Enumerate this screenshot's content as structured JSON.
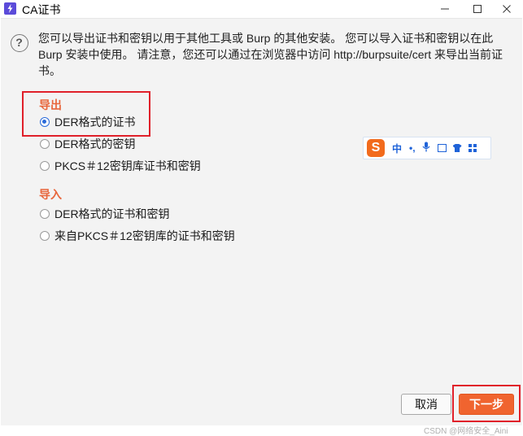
{
  "window": {
    "title": "CA证书"
  },
  "description": "您可以导出证书和密钥以用于其他工具或 Burp 的其他安装。 您可以导入证书和密钥以在此 Burp 安装中使用。 请注意，您还可以通过在浏览器中访问 http://burpsuite/cert 来导出当前证书。",
  "export": {
    "label": "导出",
    "options": [
      {
        "label": "DER格式的证书",
        "selected": true
      },
      {
        "label": "DER格式的密钥",
        "selected": false
      },
      {
        "label": "PKCS＃12密钥库证书和密钥",
        "selected": false
      }
    ]
  },
  "import": {
    "label": "导入",
    "options": [
      {
        "label": "DER格式的证书和密钥",
        "selected": false
      },
      {
        "label": "来自PKCS＃12密钥库的证书和密钥",
        "selected": false
      }
    ]
  },
  "ime_toolbar": {
    "logo": "S",
    "mode": "中",
    "punct": "•,"
  },
  "buttons": {
    "cancel": "取消",
    "next": "下一步"
  },
  "watermark": "CSDN @网络安全_Aini",
  "colors": {
    "accent": "#f0642f",
    "section": "#e8663c",
    "highlight_box": "#e0202a",
    "radio_selected": "#2a6ad9"
  }
}
